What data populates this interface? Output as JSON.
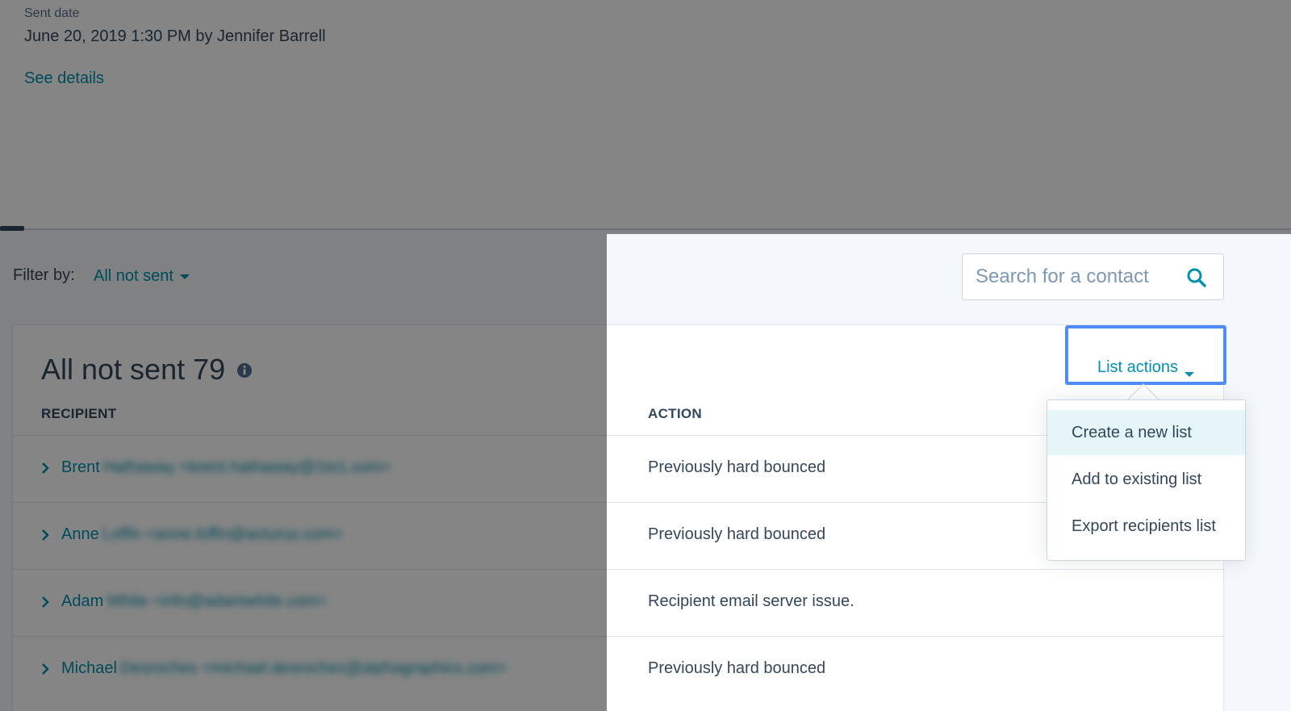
{
  "header": {
    "sent_label": "Sent date",
    "sent_value": "June 20, 2019 1:30 PM by Jennifer Barrell",
    "see_details": "See details"
  },
  "filter": {
    "label": "Filter by:",
    "value": "All not sent"
  },
  "search": {
    "placeholder": "Search for a contact"
  },
  "card": {
    "title": "All not sent 79",
    "list_actions_label": "List actions",
    "columns": {
      "recipient": "RECIPIENT",
      "action": "ACTION"
    }
  },
  "rows": [
    {
      "first_name": "Brent",
      "rest": "Hathaway <brent.hathaway@1to1.com>",
      "action": "Previously hard bounced"
    },
    {
      "first_name": "Anne",
      "rest": "Loffin <anne.loffin@acturus.com>",
      "action": "Previously hard bounced"
    },
    {
      "first_name": "Adam",
      "rest": "White <info@adamwhite.com>",
      "action": "Recipient email server issue."
    },
    {
      "first_name": "Michael",
      "rest": "Desroches <michael.desroches@alphagraphics.com>",
      "action": "Previously hard bounced"
    }
  ],
  "dropdown": {
    "items": [
      "Create a new list",
      "Add to existing list",
      "Export recipients list"
    ]
  },
  "colors": {
    "link": "#0091ae",
    "text": "#33475b",
    "focus_outline": "#4f8cf7",
    "hover_bg": "#e5f5f8"
  },
  "icons": {
    "search": "search-icon",
    "info": "info-icon",
    "chevron": "chevron-right-icon",
    "caret": "caret-down-icon"
  }
}
